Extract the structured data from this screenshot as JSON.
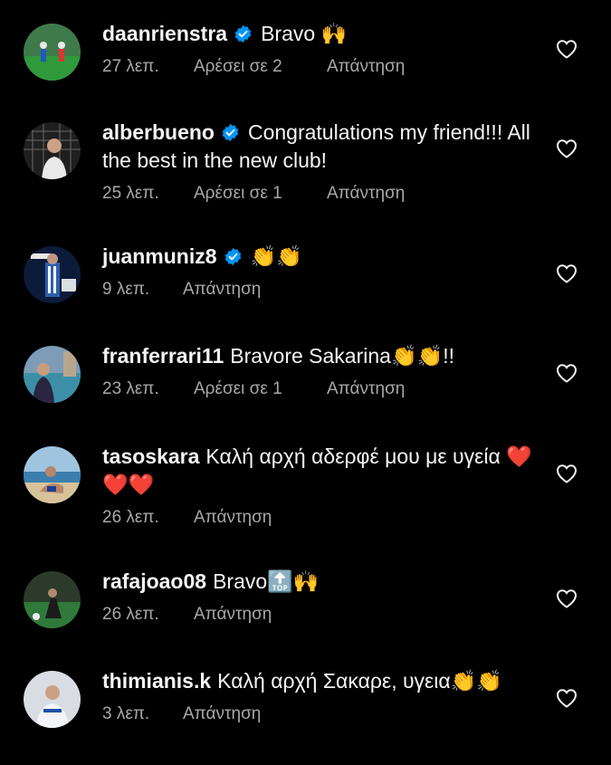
{
  "comments": [
    {
      "username": "daanrienstra",
      "text": "Bravo 🙌",
      "time": "27 λεπ.",
      "likes": "Αρέσει σε 2",
      "reply": "Απάντηση"
    },
    {
      "username": "alberbueno",
      "text": "Congratulations my friend!!! All the best in the new club!",
      "time": "25 λεπ.",
      "likes": "Αρέσει σε 1",
      "reply": "Απάντηση"
    },
    {
      "username": "juanmuniz8",
      "text": "👏👏",
      "time": "9 λεπ.",
      "reply": "Απάντηση"
    },
    {
      "username": "franferrari11",
      "text": "Bravore Sakarina👏👏!!",
      "time": "23 λεπ.",
      "likes": "Αρέσει σε 1",
      "reply": "Απάντηση"
    },
    {
      "username": "tasoskara",
      "text": "Καλή αρχή αδερφέ μου με υγεία ❤️❤️❤️",
      "time": "26 λεπ.",
      "reply": "Απάντηση"
    },
    {
      "username": "rafajoao08",
      "text": "Bravo🔝🙌",
      "time": "26 λεπ.",
      "reply": "Απάντηση"
    },
    {
      "username": "thimianis.k",
      "text": "Καλή αρχή Σακαρε, υγεια👏👏",
      "time": "3 λεπ.",
      "reply": "Απάντηση"
    }
  ],
  "icons": {
    "verified": "verified-badge-icon",
    "like": "heart-outline-icon"
  },
  "colors": {
    "background": "#000000",
    "text": "#f5f5f5",
    "secondary": "#a8a8a8",
    "verified": "#0095f6"
  }
}
